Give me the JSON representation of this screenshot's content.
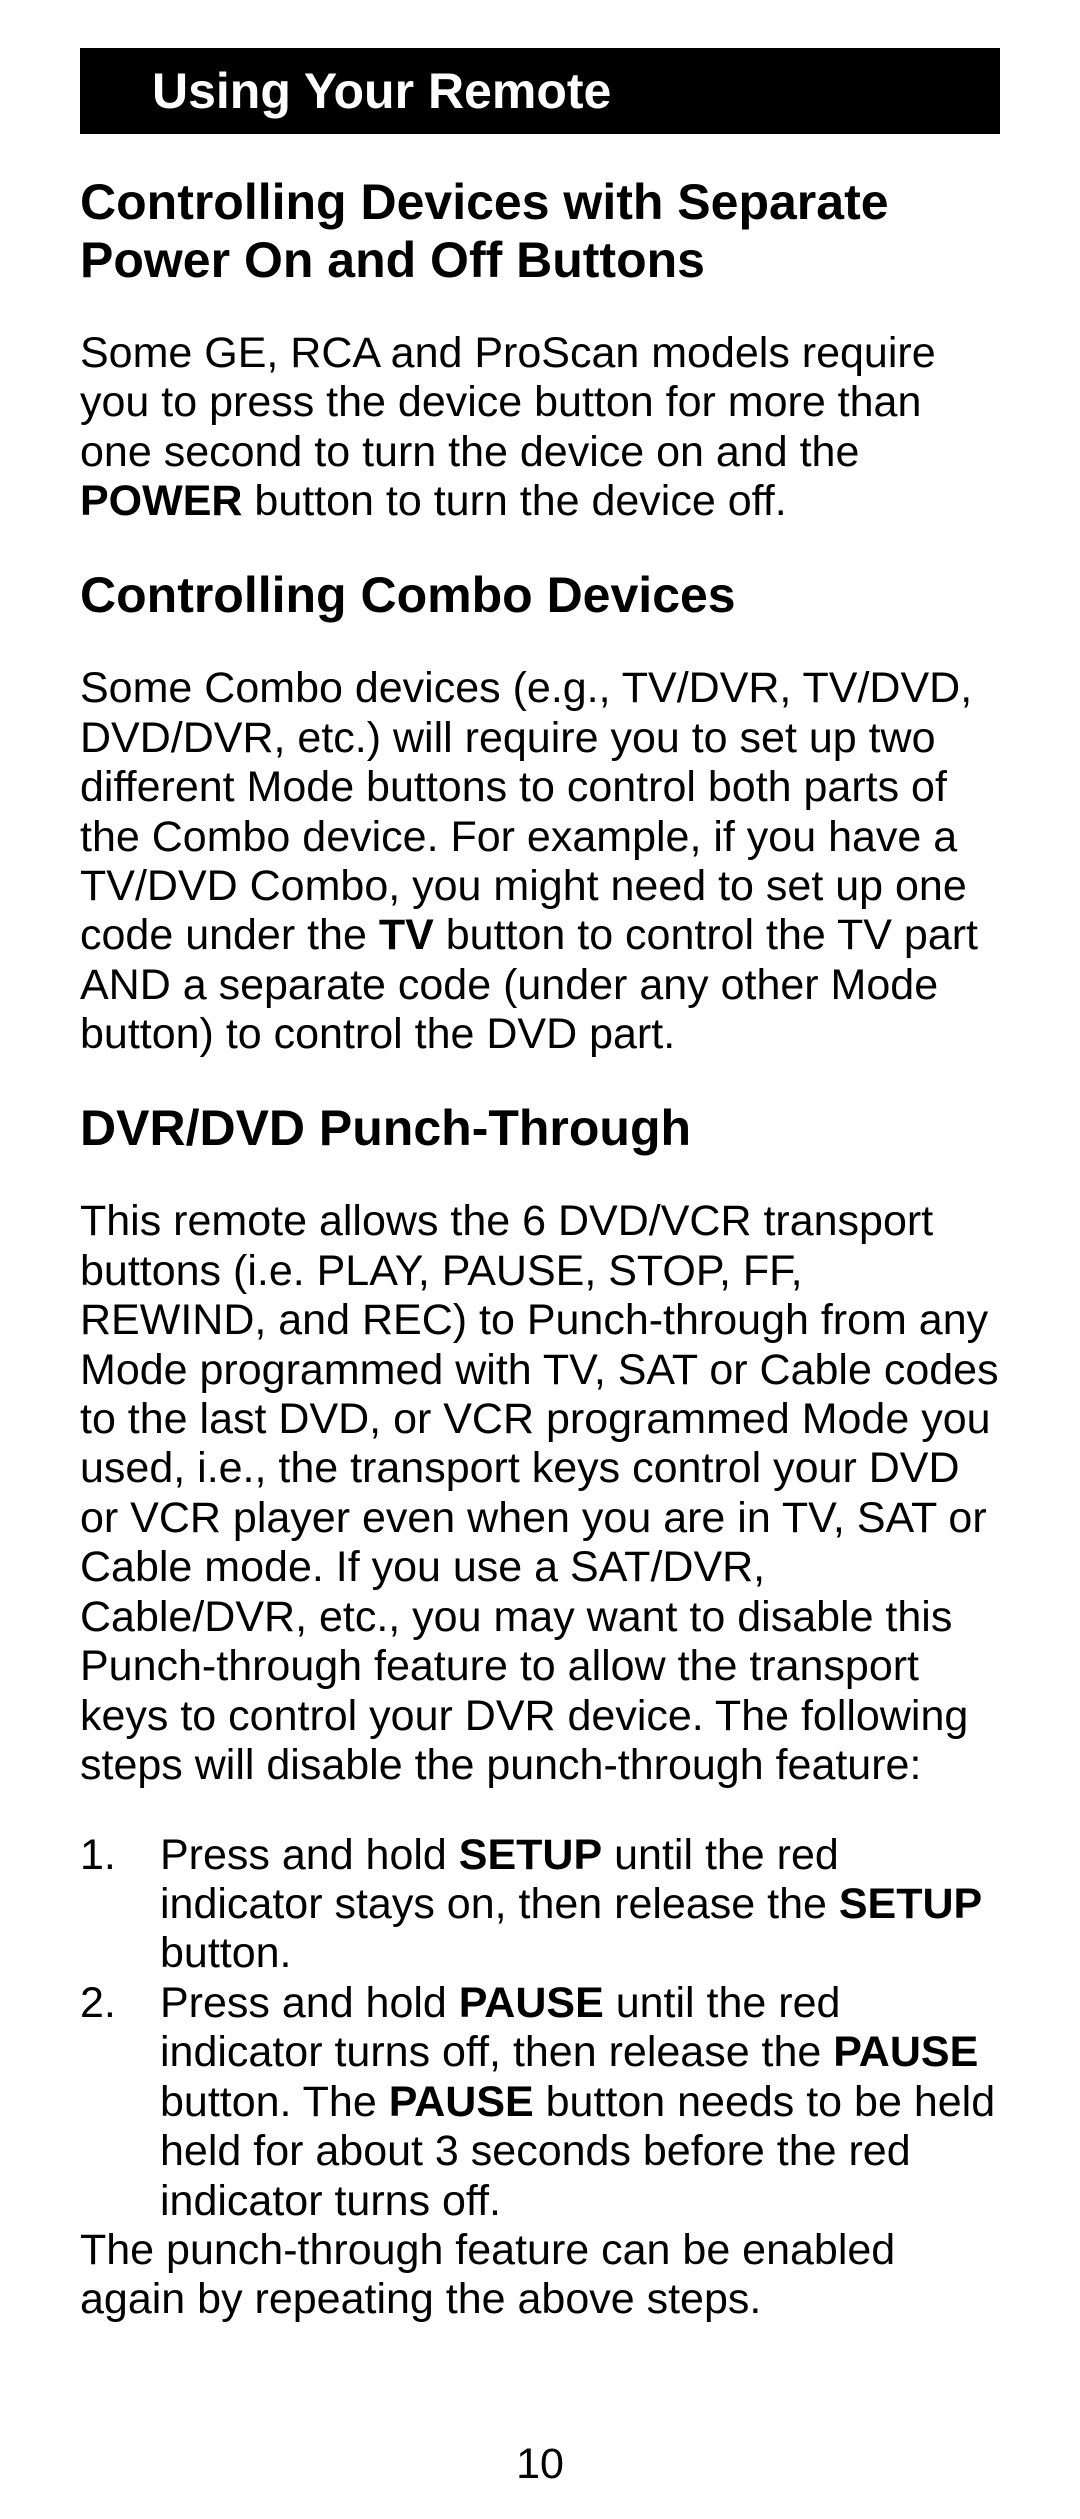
{
  "banner": "Using Your Remote",
  "h1": "Controlling Devices with Separate Power On and Off Buttons",
  "p1_a": "Some GE, RCA and ProScan models require you to press the device button for more than one second to turn the device on and the ",
  "p1_b_bold": "POWER",
  "p1_c": " button to turn the device off.",
  "h2": "Controlling Combo Devices",
  "p2_a": "Some Combo devices (e.g., TV/DVR, TV/DVD, DVD/DVR, etc.) will require you to set up two different Mode buttons to control both parts of the Combo device. For example, if you have a TV/DVD Combo, you might need to set up one code under the ",
  "p2_b_bold": "TV",
  "p2_c": " button to control the TV part AND a separate code (under any other Mode button) to control the DVD part.",
  "h3": "DVR/DVD Punch-Through",
  "p3": "This remote allows the 6 DVD/VCR transport buttons (i.e. PLAY, PAUSE, STOP, FF, REWIND, and REC) to Punch-through from any Mode programmed with TV, SAT or Cable codes to the last DVD, or VCR programmed Mode you used, i.e., the transport keys control your DVD or VCR player even when you are in TV, SAT or Cable mode. If you use a SAT/DVR, Cable/DVR, etc., you may want to disable this Punch-through feature to allow the transport keys to control your DVR device. The following steps will disable the punch-through feature:",
  "steps": {
    "s1_a": "Press and hold ",
    "s1_b_bold": "SETUP",
    "s1_c": " until the red indicator stays on, then release the ",
    "s1_d_bold": "SETUP",
    "s1_e": " button.",
    "s2_a": "Press and hold ",
    "s2_b_bold": "PAUSE",
    "s2_c": " until the red indicator turns off, then release the ",
    "s2_d_bold": "PAUSE",
    "s2_e": " button. The ",
    "s2_f_bold": "PAUSE",
    "s2_g": " button needs to be held held for about 3 seconds before the red indicator turns off."
  },
  "p4": "The punch-through feature can be enabled again by repeating the above steps.",
  "pagenum": "10"
}
